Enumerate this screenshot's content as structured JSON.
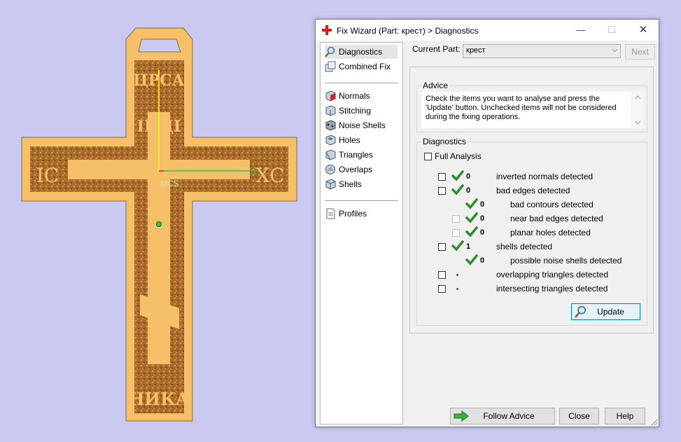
{
  "viewport": {
    "labels": {
      "top": "ЦРСА",
      "inri": "ІНЦІ",
      "left": "ІС",
      "right": "ХС",
      "bottom": "НИКА"
    },
    "measure_text": "MCS"
  },
  "window": {
    "title": "Fix Wizard (Part: крест) > Diagnostics",
    "controls": {
      "minimize": "—",
      "maximize": "☐",
      "close": "✕"
    }
  },
  "nav": {
    "items": [
      {
        "label": "Diagnostics",
        "icon": "magnifier-icon",
        "selected": true
      },
      {
        "label": "Combined Fix",
        "icon": "combined-fix-icon"
      },
      {
        "label": "Normals",
        "icon": "normals-cube-icon"
      },
      {
        "label": "Stitching",
        "icon": "stitching-cube-icon"
      },
      {
        "label": "Noise Shells",
        "icon": "noise-shells-icon"
      },
      {
        "label": "Holes",
        "icon": "holes-cube-icon"
      },
      {
        "label": "Triangles",
        "icon": "triangles-cube-icon"
      },
      {
        "label": "Overlaps",
        "icon": "overlaps-icon"
      },
      {
        "label": "Shells",
        "icon": "shells-cube-icon"
      },
      {
        "label": "Profiles",
        "icon": "profiles-page-icon"
      }
    ]
  },
  "current_part": {
    "label": "Current Part:",
    "value": "крест",
    "next_label": "Next"
  },
  "advice": {
    "title": "Advice",
    "text": "Check the items you want to analyse and press the 'Update' button. Unchecked items will not be considered during the fixing operations."
  },
  "diagnostics": {
    "title": "Diagnostics",
    "full_analysis_label": "Full Analysis",
    "rows": [
      {
        "count": "0",
        "label": "inverted normals detected",
        "status": "ok"
      },
      {
        "count": "0",
        "label": "bad edges detected",
        "status": "ok"
      },
      {
        "count": "0",
        "label": "bad contours detected",
        "status": "ok"
      },
      {
        "count": "0",
        "label": "near bad edges detected",
        "status": "ok"
      },
      {
        "count": "0",
        "label": "planar holes detected",
        "status": "ok"
      },
      {
        "count": "1",
        "label": "shells detected",
        "status": "ok"
      },
      {
        "count": "0",
        "label": "possible noise shells detected",
        "status": "ok"
      },
      {
        "count": "",
        "label": "overlapping triangles detected",
        "status": "not-analysed"
      },
      {
        "count": "",
        "label": "intersecting triangles detected",
        "status": "not-analysed"
      }
    ],
    "update_label": "Update"
  },
  "footer": {
    "follow_advice": "Follow Advice",
    "close": "Close",
    "help": "Help"
  },
  "colors": {
    "accent_tick": "#2e8b2e",
    "wood": "#f6c068",
    "dark_texture": "#9a5e22",
    "background": "#c9c9f2"
  }
}
